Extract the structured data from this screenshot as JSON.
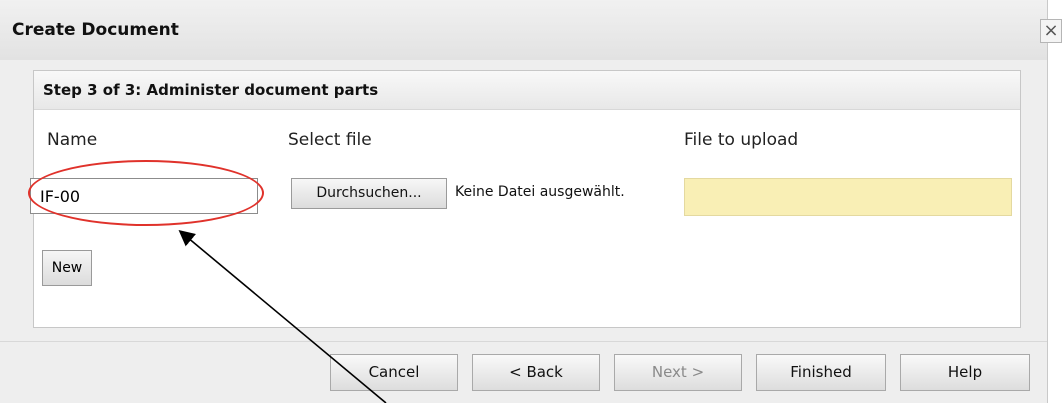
{
  "dialog": {
    "title": "Create Document",
    "close_label": "×",
    "step_title": "Step 3 of 3: Administer document parts",
    "columns": {
      "name": "Name",
      "select_file": "Select file",
      "file_to_upload": "File to upload"
    },
    "name_value": "IF-00",
    "browse_label": "Durchsuchen...",
    "no_file_text": "Keine Datei ausgewählt.",
    "new_button": "New",
    "footer_buttons": {
      "cancel": "Cancel",
      "back": "< Back",
      "next": "Next >",
      "finished": "Finished",
      "help": "Help"
    },
    "annotation_color": "#e0322b"
  }
}
